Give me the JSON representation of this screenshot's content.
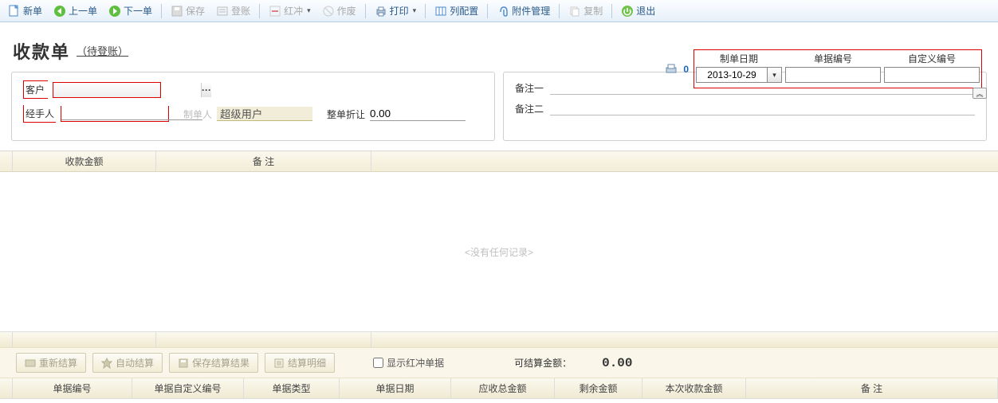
{
  "toolbar": {
    "new_doc": "新单",
    "prev": "上一单",
    "next": "下一单",
    "save": "保存",
    "post": "登账",
    "red": "红冲",
    "void": "作废",
    "print": "打印",
    "columns": "列配置",
    "attach": "附件管理",
    "copy": "复制",
    "exit": "退出"
  },
  "title": {
    "main": "收款单",
    "status": "（待登账）"
  },
  "header": {
    "print_count": "0",
    "date_label": "制单日期",
    "date_value": "2013-10-29",
    "docno_label": "单据编号",
    "docno_value": "",
    "custno_label": "自定义编号",
    "custno_value": ""
  },
  "left_panel": {
    "customer_label": "客户",
    "customer_value": "",
    "customer_lookup": "···",
    "handler_label": "经手人",
    "handler_value": "",
    "creator_label": "制单人",
    "creator_value": "超级用户",
    "discount_label": "整单折让",
    "discount_value": "0.00"
  },
  "right_panel": {
    "remark1_label": "备注一",
    "remark1_value": "",
    "remark2_label": "备注二",
    "remark2_value": ""
  },
  "grid1": {
    "col_amount": "收款金额",
    "col_remark": "备 注",
    "empty": "<没有任何记录>"
  },
  "btnbar": {
    "resettle": "重新结算",
    "autosettle": "自动结算",
    "save_result": "保存结算结果",
    "detail": "结算明细",
    "show_red": "显示红冲单据",
    "avail_label": "可结算金额：",
    "avail_value": "0.00"
  },
  "grid2": {
    "c1": "单据编号",
    "c2": "单据自定义编号",
    "c3": "单据类型",
    "c4": "单据日期",
    "c5": "应收总金额",
    "c6": "剩余金额",
    "c7": "本次收款金额",
    "c8": "备 注"
  }
}
